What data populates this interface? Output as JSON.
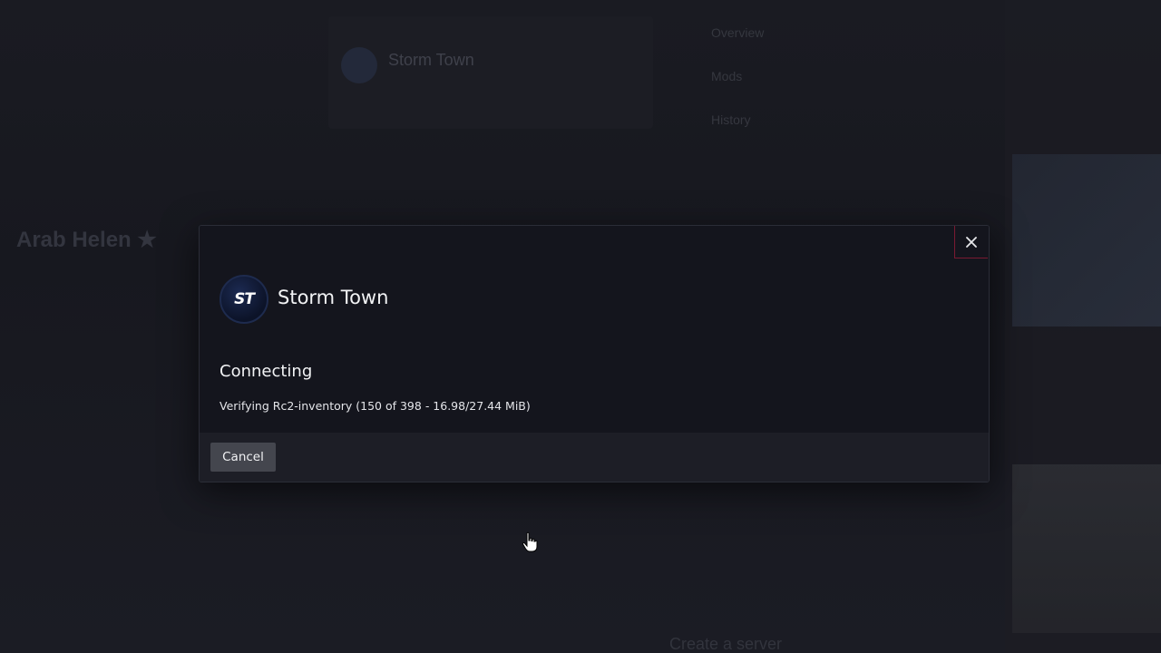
{
  "background": {
    "card_title": "Storm Town",
    "side_heading": "Arab Helen ★",
    "menu_items": [
      "Overview",
      "Mods",
      "History"
    ],
    "bottom_text": "Create a server"
  },
  "modal": {
    "server_name": "Storm Town",
    "logo_initials": "ST",
    "status_title": "Connecting",
    "status_detail": "Verifying Rc2-inventory (150 of 398 - 16.98/27.44 MiB)",
    "cancel_label": "Cancel",
    "close_icon": "close-icon"
  },
  "colors": {
    "modal_bg": "#14151d",
    "footer_bg": "#1d1e26",
    "close_border": "#7a1a32",
    "button_bg": "#44464e"
  }
}
